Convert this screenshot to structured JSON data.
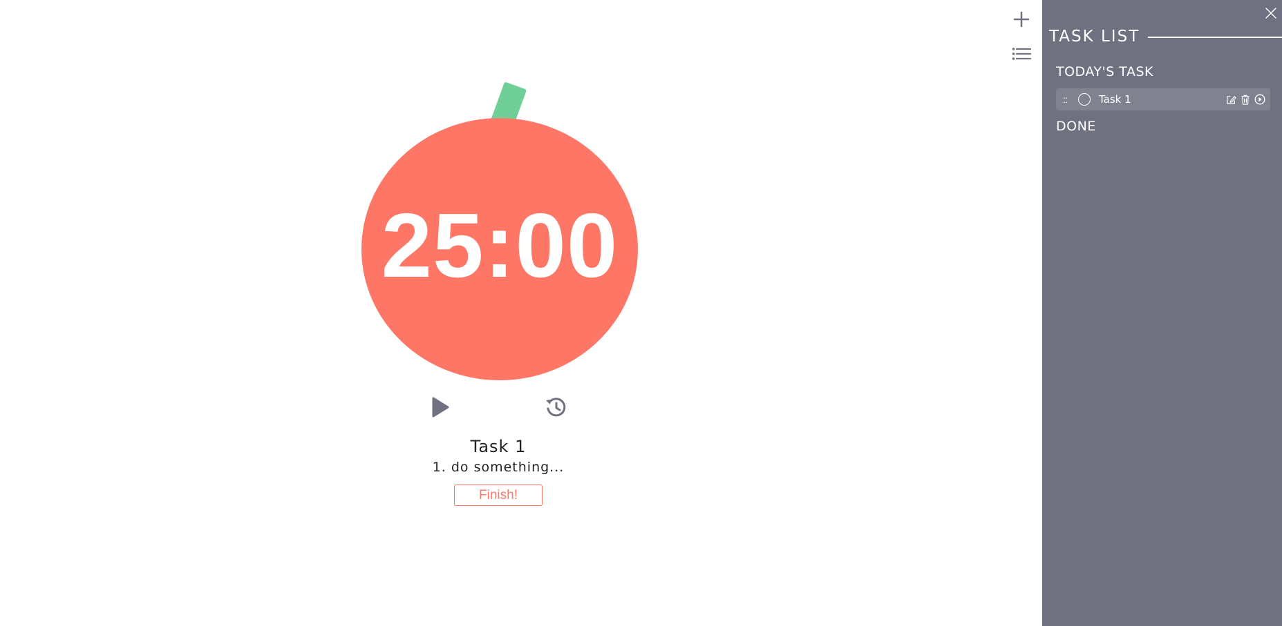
{
  "timer": {
    "display": "25:00",
    "colors": {
      "tomato": "#fe7766",
      "stem": "#6fcf97",
      "controls": "#6f7181"
    },
    "controls": {
      "play_icon": "play-icon",
      "reset_icon": "history-icon"
    }
  },
  "current_task": {
    "title": "Task 1",
    "note": "1. do something...",
    "finish_label": "Finish!"
  },
  "toolbar": {
    "add_icon": "plus-icon",
    "list_icon": "list-icon"
  },
  "task_panel": {
    "title": "TASK LIST",
    "today_label": "TODAY'S TASK",
    "done_label": "DONE",
    "background": "#6f7181",
    "tasks": [
      {
        "drag": "::",
        "label": "Task 1",
        "icons": [
          "edit-icon",
          "trash-icon",
          "play-circle-icon"
        ]
      }
    ]
  }
}
